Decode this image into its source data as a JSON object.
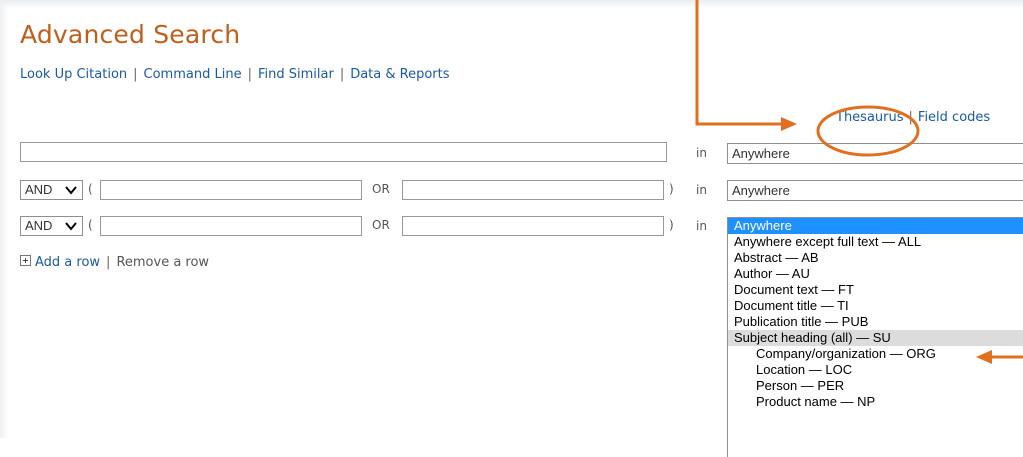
{
  "page": {
    "title": "Advanced Search"
  },
  "sublinks": {
    "items": [
      "Look Up Citation",
      "Command Line",
      "Find Similar",
      "Data & Reports"
    ],
    "separator": "|"
  },
  "top_links": {
    "thesaurus": "Thesaurus",
    "separator": "|",
    "field_codes": "Field codes"
  },
  "search_rows": {
    "in_label": "in",
    "or_label": "OR",
    "open_paren": "(",
    "close_paren": ")",
    "row1": {
      "query_value": "",
      "field_value": "Anywhere"
    },
    "row2": {
      "boolean": "AND",
      "term1_value": "",
      "term2_value": "",
      "field_value": "Anywhere"
    },
    "row3": {
      "boolean": "AND",
      "term1_value": "",
      "term2_value": ""
    }
  },
  "field_dropdown": {
    "options": [
      {
        "label": "Anywhere",
        "state": "selected",
        "indent": false
      },
      {
        "label": "Anywhere except full text — ALL",
        "state": "",
        "indent": false
      },
      {
        "label": "Abstract — AB",
        "state": "",
        "indent": false
      },
      {
        "label": "Author — AU",
        "state": "",
        "indent": false
      },
      {
        "label": "Document text — FT",
        "state": "",
        "indent": false
      },
      {
        "label": "Document title — TI",
        "state": "",
        "indent": false
      },
      {
        "label": "Publication title — PUB",
        "state": "",
        "indent": false
      },
      {
        "label": "Subject heading (all) — SU",
        "state": "hover",
        "indent": false
      },
      {
        "label": "Company/organization — ORG",
        "state": "",
        "indent": true
      },
      {
        "label": "Location — LOC",
        "state": "",
        "indent": true
      },
      {
        "label": "Person — PER",
        "state": "",
        "indent": true
      },
      {
        "label": "Product name — NP",
        "state": "",
        "indent": true
      }
    ]
  },
  "row_actions": {
    "add_row": "Add a row",
    "separator": "|",
    "remove_row": "Remove a row"
  },
  "annotations": {
    "accent_color": "#e07020",
    "highlighted_link": "Thesaurus",
    "highlighted_option": "Subject heading (all) — SU"
  },
  "colors": {
    "title": "#c25d1b",
    "link": "#1a5aa4",
    "selected_option": "#1e90ff",
    "hover_option": "#dcdcdc"
  }
}
